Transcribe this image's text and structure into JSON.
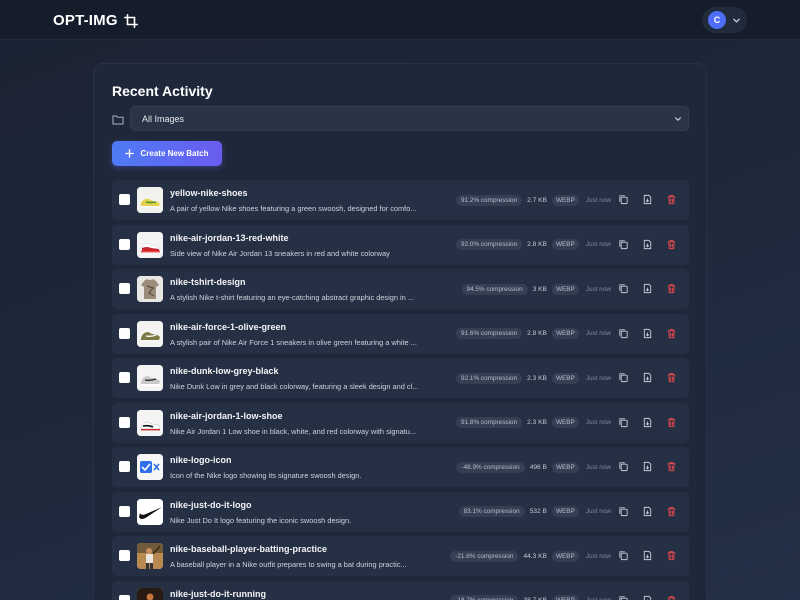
{
  "brand": {
    "name": "OPT-IMG",
    "icon": "crop-icon"
  },
  "user": {
    "initial": "C"
  },
  "panel": {
    "title": "Recent Activity",
    "filter": {
      "selected": "All Images",
      "icon": "folder-icon"
    },
    "create_button": "Create New Batch"
  },
  "rows": [
    {
      "name": "yellow-nike-shoes",
      "desc": "A pair of yellow Nike shoes featuring a green swoosh, designed for comfo...",
      "compression": "91.2% compression",
      "size": "2.7 KB",
      "format": "WEBP",
      "time": "Just now",
      "thumb": "yellow-shoe"
    },
    {
      "name": "nike-air-jordan-13-red-white",
      "desc": "Side view of Nike Air Jordan 13 sneakers in red and white colorway",
      "compression": "92.0% compression",
      "size": "2.8 KB",
      "format": "WEBP",
      "time": "Just now",
      "thumb": "red-shoe"
    },
    {
      "name": "nike-tshirt-design",
      "desc": "A stylish Nike t-shirt featuring an eye-catching abstract graphic design in ...",
      "compression": "94.5% compression",
      "size": "3 KB",
      "format": "WEBP",
      "time": "Just now",
      "thumb": "tshirt"
    },
    {
      "name": "nike-air-force-1-olive-green",
      "desc": "A stylish pair of Nike Air Force 1 sneakers in olive green featuring a white ...",
      "compression": "91.6% compression",
      "size": "2.8 KB",
      "format": "WEBP",
      "time": "Just now",
      "thumb": "olive-shoe"
    },
    {
      "name": "nike-dunk-low-grey-black",
      "desc": "Nike Dunk Low in grey and black colorway, featuring a sleek design and cl...",
      "compression": "92.1% compression",
      "size": "2.3 KB",
      "format": "WEBP",
      "time": "Just now",
      "thumb": "grey-shoe"
    },
    {
      "name": "nike-air-jordan-1-low-shoe",
      "desc": "Nike Air Jordan 1 Low shoe in black, white, and red colorway with signatu...",
      "compression": "91.8% compression",
      "size": "2.3 KB",
      "format": "WEBP",
      "time": "Just now",
      "thumb": "jordan-low"
    },
    {
      "name": "nike-logo-icon",
      "desc": "Icon of the Nike logo showing its signature swoosh design.",
      "compression": "-48.9% compression",
      "size": "496 B",
      "format": "WEBP",
      "time": "Just now",
      "thumb": "logo-icon"
    },
    {
      "name": "nike-just-do-it-logo",
      "desc": "Nike Just Do It logo featuring the iconic swoosh design.",
      "compression": "83.1% compression",
      "size": "532 B",
      "format": "WEBP",
      "time": "Just now",
      "thumb": "swoosh"
    },
    {
      "name": "nike-baseball-player-batting-practice",
      "desc": "A baseball player in a Nike outfit prepares to swing a bat during practic...",
      "compression": "-21.6% compression",
      "size": "44.3 KB",
      "format": "WEBP",
      "time": "Just now",
      "thumb": "baseball"
    },
    {
      "name": "nike-just-do-it-running",
      "desc": "",
      "compression": "-18.7% compression",
      "size": "38.7 KB",
      "format": "WEBP",
      "time": "Just now",
      "thumb": "running"
    }
  ],
  "row_actions": {
    "copy_icon": "copy-icon",
    "download_icon": "file-download-icon",
    "delete_icon": "trash-icon"
  },
  "colors": {
    "accent": "#4f7bf5",
    "accent2": "#6a5cf0",
    "danger": "#e5484d",
    "panel": "#1f283a",
    "row": "#263045"
  }
}
